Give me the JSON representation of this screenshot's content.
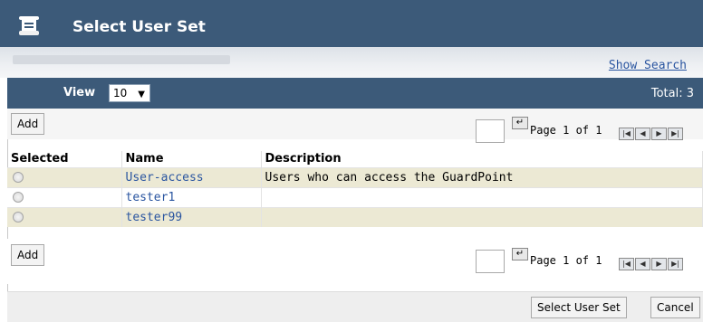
{
  "dialog": {
    "title": "Select User Set",
    "show_search_label": "Show Search"
  },
  "view_bar": {
    "view_label": "View",
    "page_size": "10",
    "total_label": "Total: 3"
  },
  "toolbar_top": {
    "add_label": "Add",
    "page_input_value": "",
    "page_label": "Page 1 of 1"
  },
  "table": {
    "columns": [
      "Selected",
      "Name",
      "Description"
    ],
    "rows": [
      {
        "name": "User-access",
        "description": "Users who can access the GuardPoint"
      },
      {
        "name": "tester1",
        "description": ""
      },
      {
        "name": "tester99",
        "description": ""
      }
    ]
  },
  "toolbar_bottom": {
    "add_label": "Add",
    "page_input_value": "",
    "page_label": "Page 1 of 1"
  },
  "footer": {
    "select_label": "Select User Set",
    "cancel_label": "Cancel"
  },
  "colors": {
    "header_bar": "#3c5a79",
    "row_highlight": "#ece9d4",
    "link": "#2a55a0"
  },
  "icons": {
    "title": "scroll-document-icon",
    "go": "enter-arrow-icon",
    "nav": [
      "first-page-icon",
      "previous-page-icon",
      "next-page-icon",
      "last-page-icon"
    ]
  }
}
